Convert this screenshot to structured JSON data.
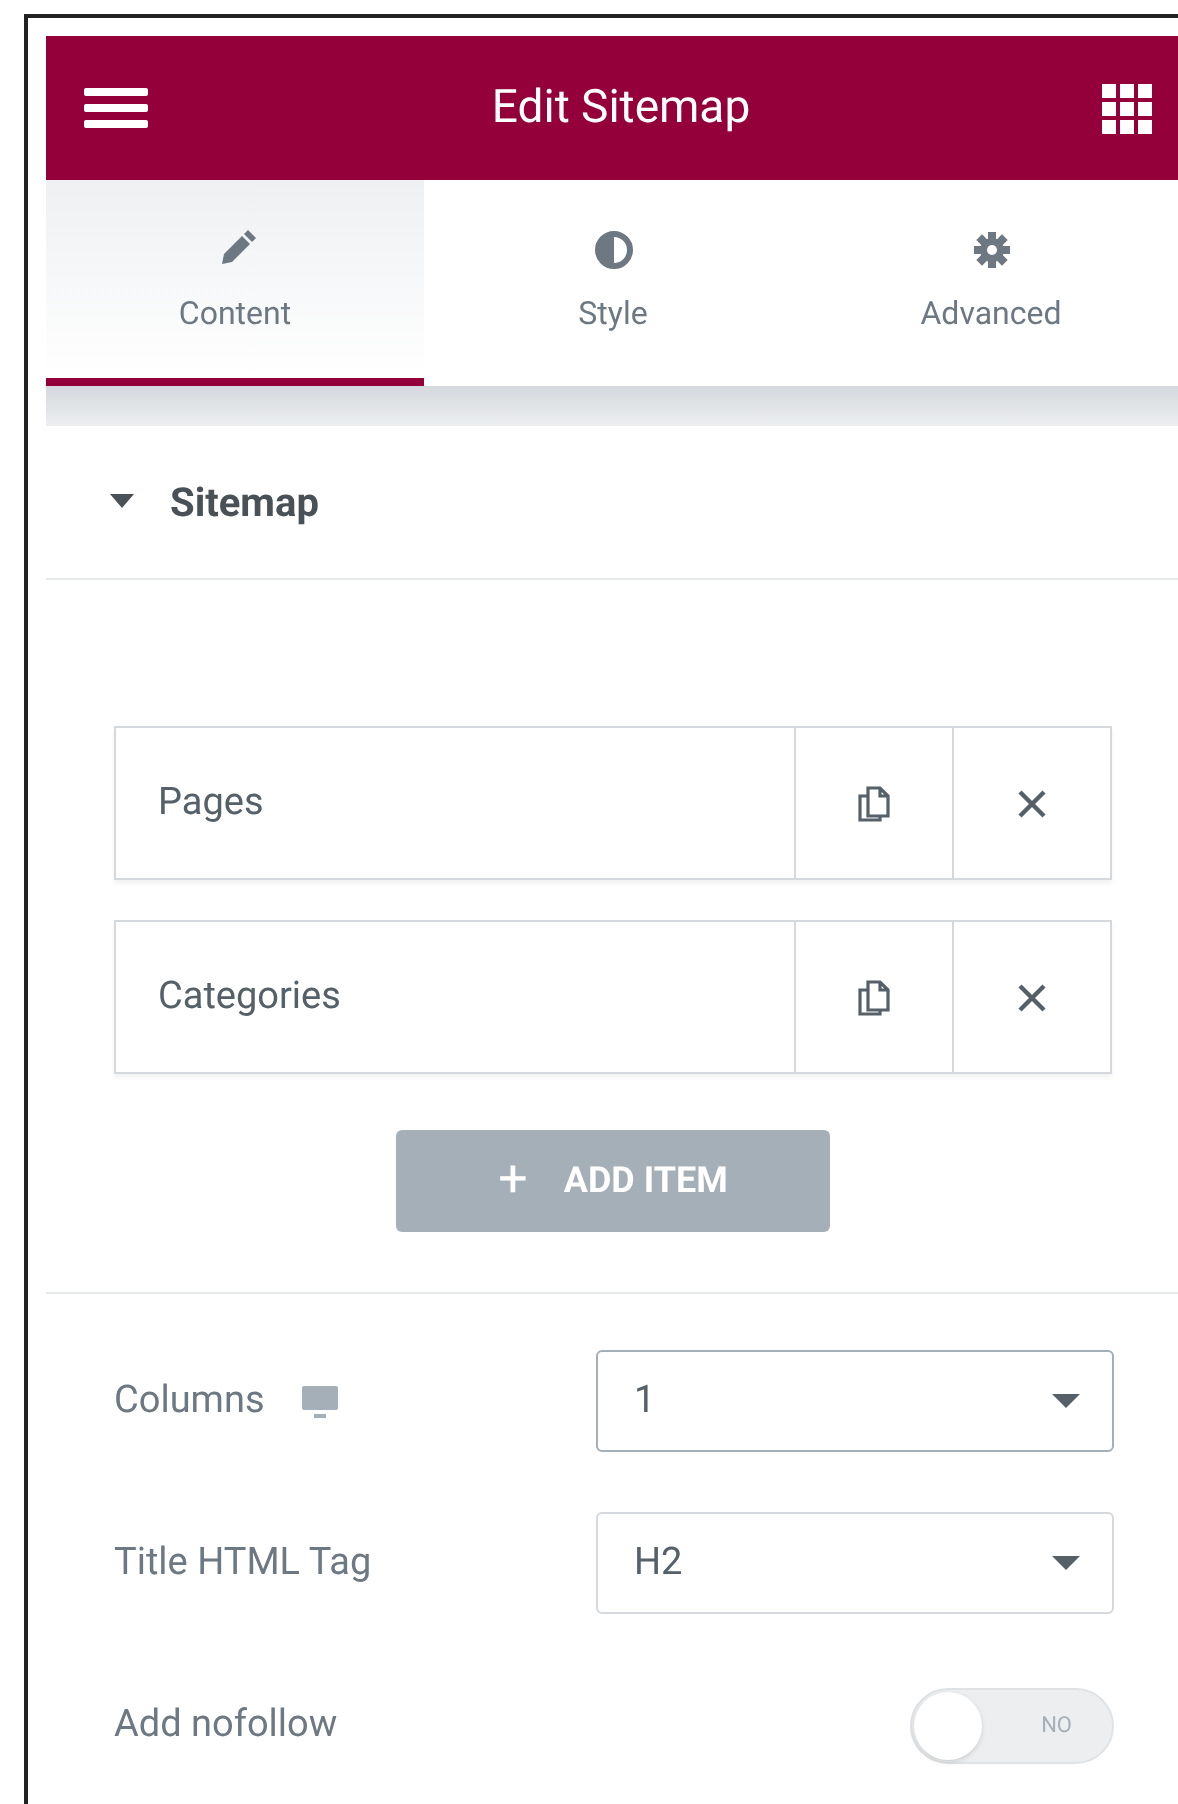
{
  "header": {
    "title": "Edit Sitemap"
  },
  "tabs": [
    {
      "label": "Content",
      "kind": "pencil",
      "selected": true
    },
    {
      "label": "Style",
      "kind": "contrast",
      "selected": false
    },
    {
      "label": "Advanced",
      "kind": "gear",
      "selected": false
    }
  ],
  "section": {
    "title": "Sitemap",
    "expanded": true
  },
  "repeater_items": [
    {
      "label": "Pages"
    },
    {
      "label": "Categories"
    }
  ],
  "add_item_button": {
    "icon": "+",
    "label": "ADD ITEM"
  },
  "controls": [
    {
      "kind": "select",
      "label": "Columns",
      "responsive": true,
      "value": "1",
      "focused": true
    },
    {
      "kind": "select",
      "label": "Title HTML Tag",
      "responsive": false,
      "value": "H2",
      "focused": false
    },
    {
      "kind": "toggle",
      "label": "Add nofollow",
      "on": false,
      "state_label": "NO"
    }
  ]
}
